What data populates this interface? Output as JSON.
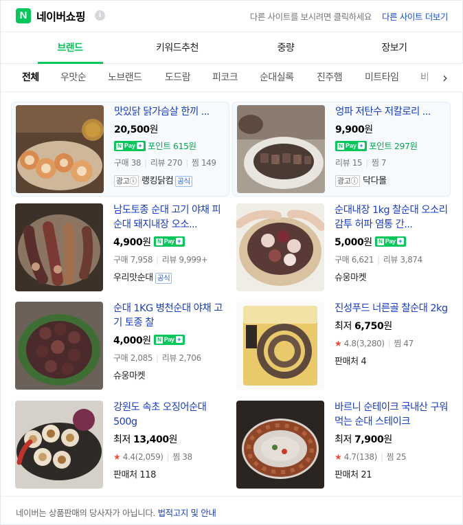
{
  "header": {
    "logo_letter": "N",
    "title": "네이버쇼핑",
    "info_symbol": "i",
    "hint": "다른 사이트를 보시려면 클릭하세요",
    "link": "다른 사이트 더보기"
  },
  "tabs": [
    {
      "label": "브랜드",
      "active": true
    },
    {
      "label": "키워드추천"
    },
    {
      "label": "중량"
    },
    {
      "label": "장보기"
    }
  ],
  "chips": [
    "전체",
    "우맛순",
    "노브랜드",
    "도드람",
    "피코크",
    "순대실록",
    "진주햄",
    "미트타임",
    "비"
  ],
  "chips_next": "›",
  "npay": {
    "n": "N",
    "text": "Pay",
    "plus": "+"
  },
  "products": [
    {
      "title": "맛있닭 닭가슴살 한끼 ...",
      "price": "20,500",
      "unit": "원",
      "npay": true,
      "point": "포인트 615원",
      "meta": [
        "구매 38",
        "리뷰 270",
        "찜 149"
      ],
      "ad": "광고ⓘ",
      "seller": "랭킹닭컴",
      "official": "공식"
    },
    {
      "title": "엉파 저탄수 저칼로리 ...",
      "price": "9,900",
      "unit": "원",
      "npay": true,
      "point": "포인트 297원",
      "meta": [
        "리뷰 15",
        "찜 7"
      ],
      "ad": "광고ⓘ",
      "seller": "닥다몰"
    },
    {
      "title": "남도토종 순대 고기 야채 피순대 돼지내장 오소...",
      "price": "4,900",
      "unit": "원",
      "npay": true,
      "meta": [
        "구매 7,958",
        "리뷰 9,999+"
      ],
      "seller": "우리맛순대",
      "official": "공식"
    },
    {
      "title": "순대내장 1kg 찰순대 오소리감투 허파 염통 간...",
      "price": "5,000",
      "unit": "원",
      "npay": true,
      "meta": [
        "구매 6,621",
        "리뷰 3,874"
      ],
      "seller": "슈웅마켓"
    },
    {
      "title": "순대 1KG 병천순대 야채 고기 토종 찰",
      "price": "4,000",
      "unit": "원",
      "npay": true,
      "meta": [
        "구매 2,085",
        "리뷰 2,706"
      ],
      "seller": "슈웅마켓"
    },
    {
      "title": "진성푸드 너른골 찰순대 2kg",
      "price_prefix": "최저",
      "price": "6,750",
      "unit": "원",
      "rating": "4.8(3,280)",
      "zzim": "찜 47",
      "seller_label": "판매처 4"
    },
    {
      "title": "강원도 속초 오징어순대 500g",
      "price_prefix": "최저",
      "price": "13,400",
      "unit": "원",
      "rating": "4.4(2,059)",
      "zzim": "찜 38",
      "seller_label": "판매처 118"
    },
    {
      "title": "바르니 순테이크 국내산 구워먹는 순대 스테이크",
      "price_prefix": "최저",
      "price": "7,900",
      "unit": "원",
      "rating": "4.7(138)",
      "zzim": "찜 25",
      "seller_label": "판매처 21"
    }
  ],
  "star": "★",
  "footer": {
    "text": "네이버는 상품판매의 당사자가 아닙니다.",
    "link": "법적고지 및 안내"
  },
  "colors": {
    "brand_green": "#03c75a",
    "title_blue": "#1a3dc4",
    "star_red": "#f04b3a"
  }
}
